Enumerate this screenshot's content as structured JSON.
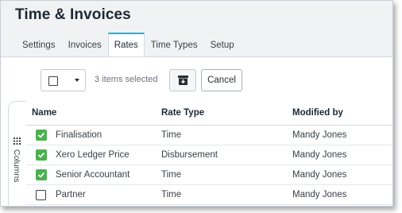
{
  "page": {
    "title": "Time & Invoices"
  },
  "tabs": [
    {
      "label": "Settings",
      "active": false
    },
    {
      "label": "Invoices",
      "active": false
    },
    {
      "label": "Rates",
      "active": true
    },
    {
      "label": "Time Types",
      "active": false
    },
    {
      "label": "Setup",
      "active": false
    }
  ],
  "toolbar": {
    "selected_text": "3 items selected",
    "cancel_label": "Cancel",
    "archive_icon": "archive-icon",
    "select_all_icon": "checkbox-dropdown-icon"
  },
  "columns_panel": {
    "label": "Columns",
    "icon": "grid-icon"
  },
  "table": {
    "headers": {
      "name": "Name",
      "rate_type": "Rate Type",
      "modified_by": "Modified by"
    },
    "rows": [
      {
        "checked": true,
        "name": "Finalisation",
        "rate_type": "Time",
        "modified_by": "Mandy Jones"
      },
      {
        "checked": true,
        "name": "Xero Ledger Price",
        "rate_type": "Disbursement",
        "modified_by": "Mandy Jones"
      },
      {
        "checked": true,
        "name": "Senior Accountant",
        "rate_type": "Time",
        "modified_by": "Mandy Jones"
      },
      {
        "checked": false,
        "name": "Partner",
        "rate_type": "Time",
        "modified_by": "Mandy Jones"
      }
    ]
  },
  "colors": {
    "accent": "#13b5ea",
    "checkbox_checked": "#4caf50",
    "background": "#f1f2f4"
  }
}
